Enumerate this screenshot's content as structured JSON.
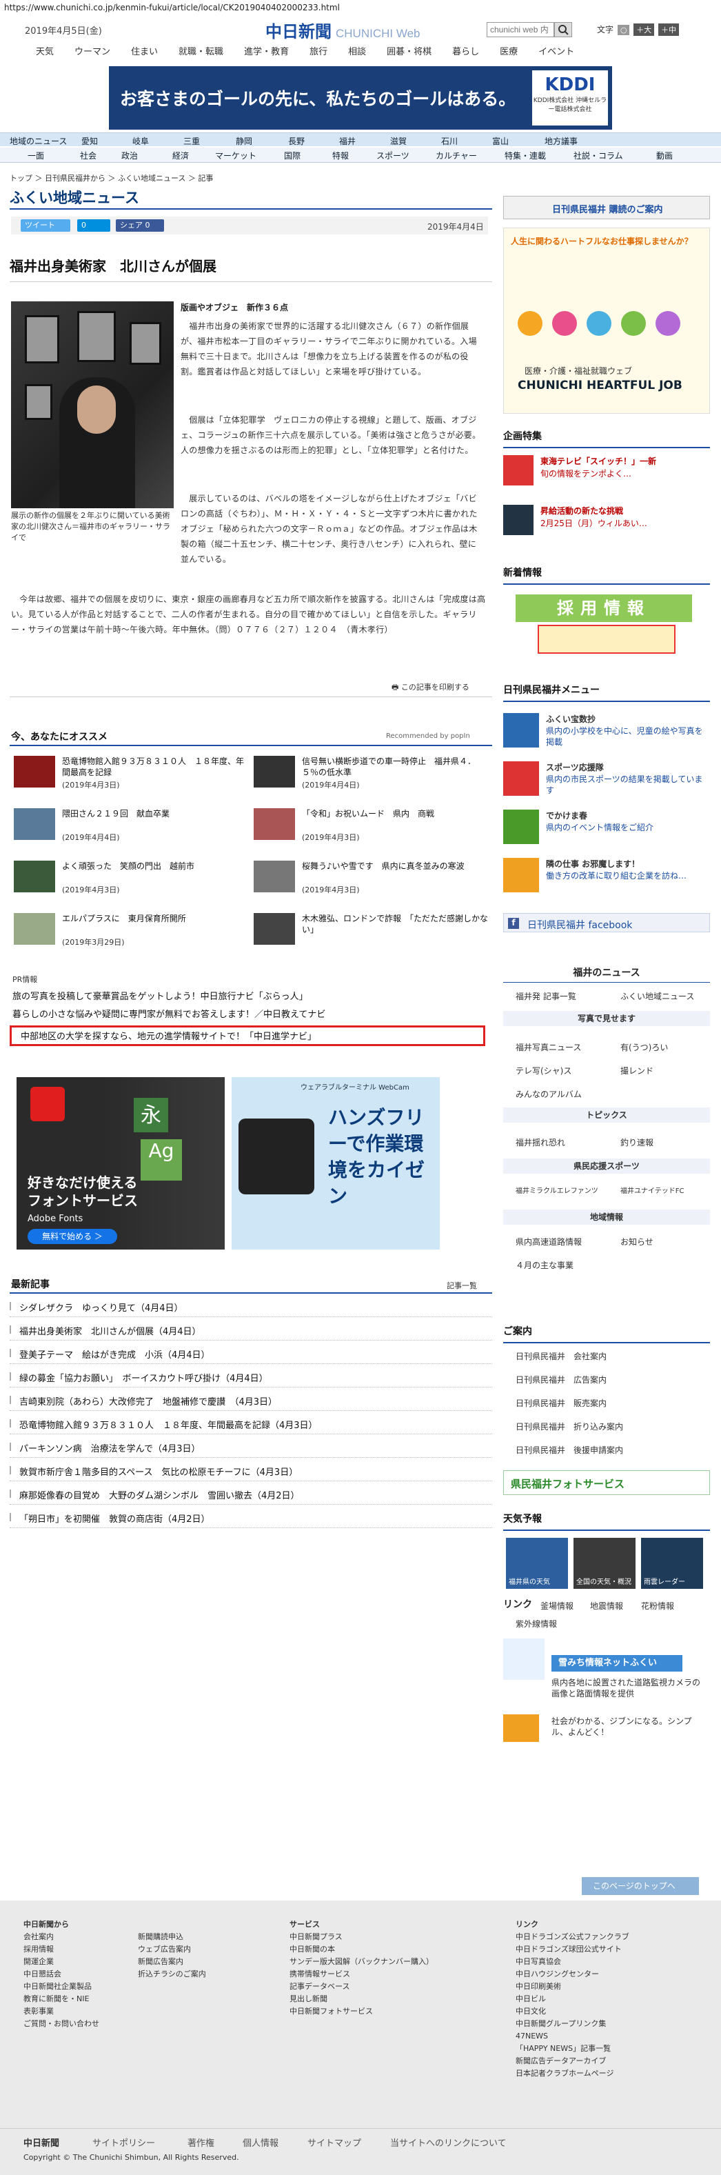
{
  "browser": {
    "url": "https://www.chunichi.co.jp/kenmin-fukui/article/local/CK2019040402000233.html"
  },
  "header": {
    "date": "2019年4月5日(金)",
    "logo": "中日新聞",
    "logo_sub": "CHUNICHI Web",
    "search_placeholder": "chunichi web 内",
    "font_label": "文字",
    "font_big": "＋大",
    "font_med": "＋中"
  },
  "global_nav": [
    "天気",
    "ウーマン",
    "住まい",
    "就職・転職",
    "進学・教育",
    "旅行",
    "相談",
    "囲碁・将棋",
    "暮らし",
    "医療",
    "イベント"
  ],
  "banner": {
    "text": "お客さまのゴールの先に、私たちのゴールはある。",
    "brand": "KDDI",
    "brand_sub": "KDDI株式会社 沖縄セルラー電話株式会社"
  },
  "nav_row1": [
    "地域のニュース",
    "愛知",
    "岐阜",
    "三重",
    "静岡",
    "長野",
    "福井",
    "滋賀",
    "石川",
    "富山",
    "地方議事"
  ],
  "nav_row2": [
    "一面",
    "社会",
    "政治",
    "経済",
    "マーケット",
    "国際",
    "特報",
    "スポーツ",
    "カルチャー",
    "特集・連載",
    "社説・コラム",
    "動画"
  ],
  "breadcrumb": "トップ ＞ 日刊県民福井から ＞ ふくい地域ニュース ＞ 記事",
  "page_title": "ふくい地域ニュース",
  "share": {
    "tweet": "ツイート",
    "hatena": "0",
    "facebook": "シェア 0"
  },
  "article": {
    "date": "2019年4月4日",
    "title": "福井出身美術家　北川さんが個展",
    "subtitle": "版画やオブジェ　新作３６点",
    "caption": "展示の新作の個展を２年ぶりに開いている美術家の北川健次さん＝福井市のギャラリー・サライで",
    "p1": "　福井市出身の美術家で世界的に活躍する北川健次さん（６７）の新作個展が、福井市松本一丁目のギャラリー・サライで二年ぶりに開かれている。入場無料で三十日まで。北川さんは「想像力を立ち上げる装置を作るのが私の役割。鑑賞者は作品と対話してほしい」と来場を呼び掛けている。",
    "p2": "　個展は「立体犯罪学　ヴェロニカの停止する視線」と題して、版画、オブジェ、コラージュの新作三十六点を展示している。「美術は強さと危うさが必要。人の想像力を揺さぶるのは形而上的犯罪」とし、「立体犯罪学」と名付けた。",
    "p3": "　展示しているのは、バベルの塔をイメージしながら仕上げたオブジェ「バビロンの高話（ぐちわ）」、Ｍ・Ｈ・Ｘ・Ｙ・４・Ｓと一文字ずつ木片に書かれたオブジェ「秘められた六つの文字－Ｒｏｍａ」などの作品。オブジェ作品は木製の箱（縦二十五センチ、横二十センチ、奥行き八センチ）に入れられ、壁に並んでいる。",
    "p4": "　今年は故郷、福井での個展を皮切りに、東京・銀座の画廊春月など五カ所で順次新作を披露する。北川さんは「完成度は高い。見ている人が作品と対話することで、二人の作者が生まれる。自分の目で確かめてほしい」と自信を示した。ギャラリー・サライの営業は午前十時～午後六時。年中無休。（問）０７７６（２７）１２０４　（青木孝行）",
    "print_label": "この記事を印刷する"
  },
  "recommend": {
    "title": "今、あなたにオススメ",
    "powered": "Recommended by popIn",
    "items": [
      {
        "title": "恐竜博物館入館９３万８３１０人　１８年度、年間最高を記録",
        "date": "(2019年4月3日)"
      },
      {
        "title": "信号無い横断歩道での車一時停止　福井県４．５％の低水準",
        "date": "(2019年4月4日)"
      },
      {
        "title": "隈田さん２１９回　献血卒業",
        "date": "(2019年4月4日)"
      },
      {
        "title": "「令和」お祝いムード　県内　商戦",
        "date": "(2019年4月3日)"
      },
      {
        "title": "よく頑張った　笑顔の門出　越前市",
        "date": "(2019年4月3日)"
      },
      {
        "title": "桜舞う♪いや雪です　県内に真冬並みの寒波",
        "date": "(2019年4月3日)"
      },
      {
        "title": "エルパプラスに　東月保育所開所",
        "date": "(2019年3月29日)"
      },
      {
        "title": "木木雅弘、ロンドンで詐報　「ただただ感謝しかない」",
        "date": ""
      }
    ]
  },
  "pr": {
    "label": "PR情報",
    "links": [
      "旅の写真を投稿して豪華賞品をゲットしよう！中日旅行ナビ「ぶらっ人」",
      "暮らしの小さな悩みや疑問に専門家が無料でお答えします！／中日教えてナビ",
      "中部地区の大学を探すなら、地元の進学情報サイトで！「中日進学ナビ」"
    ]
  },
  "ads": {
    "adobe_text": "好きなだけ使えるフォントサービス",
    "adobe_brand": "Adobe Fonts",
    "adobe_btn": "無料で始める ＞",
    "wear_text": "ハンズフリーで作業環境をカイゼン",
    "wear_brand": "ウェアラブルターミナル WebCam"
  },
  "latest": {
    "title": "最新記事",
    "more": "記事一覧",
    "items": [
      "シダレザクラ　ゆっくり見て（4月4日）",
      "福井出身美術家　北川さんが個展（4月4日）",
      "登美子テーマ　絵はがき完成　小浜（4月4日）",
      "緑の募金「協力お願い」　ボーイスカウト呼び掛け（4月4日）",
      "吉崎東別院（あわら）大改修完了　地盤補修で慶讃　（4月3日）",
      "恐竜博物館入館９３万８３１０人　１８年度、年間最高を記録（4月3日）",
      "パーキンソン病　治療法を学んで（4月3日）",
      "敦賀市新庁舎１階多目的スペース　気比の松原モチーフに（4月3日）",
      "麻那姫像春の目覚め　大野のダム湖シンボル　雪囲い撤去（4月2日）",
      "「朔日市」を初開催　敦賀の商店街（4月2日）"
    ]
  },
  "sidebar": {
    "subscribe": "日刊県民福井 購読のご案内",
    "job_title": "人生に関わるハートフルなお仕事探しませんか？",
    "job_brand": "CHUNICHI HEARTFUL JOB",
    "job_sub": "医療・介護・福祉就職ウェブ",
    "project_title": "企画特集",
    "project_items": [
      {
        "title": "東海テレビ「スイッチ！」一新",
        "desc": "旬の情報をテンポよく…"
      },
      {
        "title": "昇給活動の新たな挑戦",
        "desc": "2月25日（月）ウィルあい…"
      }
    ],
    "recruit_title": "新着情報",
    "recruit_banner": "採用情報",
    "menu_title": "日刊県民福井メニュー",
    "menu_items": [
      {
        "title": "ふくい宝数抄",
        "desc": "県内の小学校を中心に、児童の絵や写真を掲載"
      },
      {
        "title": "スポーツ応援隊",
        "desc": "県内の市民スポーツの結果を掲載しています"
      },
      {
        "title": "でかけま春",
        "desc": "県内のイベント情報をご紹介"
      },
      {
        "title": "隣の仕事 お邪魔します！",
        "desc": "働き方の改革に取り組む企業を訪ね…"
      }
    ],
    "facebook": "日刊県民福井 facebook",
    "fukui_news": "福井のニュース",
    "fn_links": [
      "福井発 記事一覧",
      "ふくい地域ニュース"
    ],
    "photo_title": "写真で見せます",
    "photo_links": [
      "福井写真ニュース",
      "有(うつ)ろい",
      "テレ写(シャ)ス",
      "撮レンド",
      "みんなのアルバム"
    ],
    "topics_title": "トピックス",
    "topics_links": [
      "福井揺れ恐れ",
      "釣り速報"
    ],
    "sports_title": "県民応援スポーツ",
    "sports_links": [
      "福井ミラクルエレファンツ",
      "福井ユナイテッドFC"
    ],
    "area_title": "地域情報",
    "area_links": [
      "県内高速道路情報",
      "お知らせ",
      "４月の主な事業"
    ],
    "info_title": "ご案内",
    "info_links": [
      "日刊県民福井　会社案内",
      "日刊県民福井　広告案内",
      "日刊県民福井　販売案内",
      "日刊県民福井　折り込み案内",
      "日刊県民福井　後援申請案内"
    ],
    "photo_service": "県民福井フォトサービス",
    "weather_title": "天気予報",
    "weather_tiles": [
      "福井県の天気",
      "全国の天気・概況",
      "雨雲レーダー"
    ],
    "link_title": "リンク",
    "link_checks": [
      "釜場情報",
      "地震情報",
      "花粉情報",
      "紫外線情報"
    ],
    "snow_title": "雪みち情報ネットふくい",
    "snow_desc": "県内各地に設置された道路監視カメラの画像と路面情報を提供",
    "nihon_desc": "社会がわかる、ジブンになる。シンプル、よんどく！"
  },
  "totop": "このページのトップへ",
  "footer": {
    "col1_title": "中日新聞から",
    "col1": [
      "会社案内",
      "採用情報",
      "開運企業",
      "中日懇話会",
      "中日新聞社企業製品",
      "教育に新聞を・NIE",
      "表彰事業",
      "ご質問・お問い合わせ"
    ],
    "col1b": [
      "新聞購読申込",
      "ウェブ広告案内",
      "新聞広告案内",
      "折込チラシのご案内"
    ],
    "col2_title": "サービス",
    "col2": [
      "中日新聞プラス",
      "中日新聞の本",
      "サンデー版大図解（バックナンバー購入）",
      "携帯情報サービス",
      "記事データベース",
      "見出し新聞",
      "中日新聞フォトサービス"
    ],
    "col3_title": "リンク",
    "col3": [
      "中日ドラゴンズ公式ファンクラブ",
      "中日ドラゴンズ球団公式サイト",
      "中日写真協会",
      "中日ハウジングセンター",
      "中日印刷美術",
      "中日ビル",
      "中日文化",
      "中日新聞グループリンク集",
      "47NEWS",
      "「HAPPY NEWS」記事一覧",
      "新聞広告データアーカイブ",
      "日本記者クラブホームページ"
    ],
    "nav": [
      "中日新聞",
      "サイトポリシー",
      "著作権",
      "個人情報",
      "サイトマップ",
      "当サイトへのリンクについて"
    ],
    "copyright": "Copyright © The Chunichi Shimbun, All Rights Reserved."
  },
  "colors": {
    "brand": "#1b4ea1",
    "highlight_box": "#e02020",
    "tweet": "#55acee",
    "facebook": "#3b5998"
  }
}
